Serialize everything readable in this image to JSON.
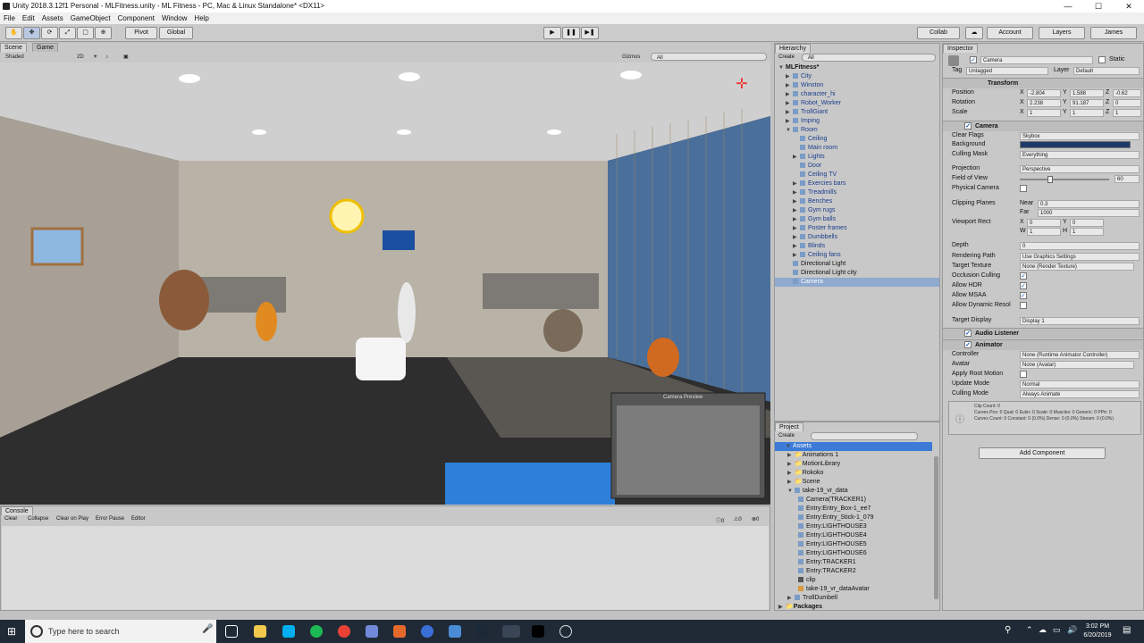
{
  "window": {
    "title": "Unity 2018.3.12f1 Personal - MLFitness.unity - ML Fitness - PC, Mac & Linux Standalone* <DX11>",
    "minimize": "—",
    "maximize": "☐",
    "close": "✕"
  },
  "menu": [
    "File",
    "Edit",
    "Assets",
    "GameObject",
    "Component",
    "Window",
    "Help"
  ],
  "toolbar": {
    "pivot": "Pivot",
    "global": "Global",
    "play": "▶",
    "pause": "❚❚",
    "step": "▶❚",
    "collab": "Collab",
    "account": "Account",
    "layers": "Layers",
    "layout": "James"
  },
  "scene": {
    "tab_scene": "Scene",
    "tab_game": "Game",
    "shading": "Shaded",
    "mode_2d": "2D",
    "gizmos": "Gizmos",
    "search_placeholder": "All",
    "camera_preview": "Camera Preview"
  },
  "hierarchy": {
    "tab": "Hierarchy",
    "create": "Create",
    "search_placeholder": "All",
    "root": "MLFitness*",
    "items": [
      "City",
      "Winston",
      "character_hi",
      "Robot_Worker",
      "TrollGiant",
      "Imping",
      "Room",
      "Ceiling",
      "Main room",
      "Lights",
      "Door",
      "Ceiling TV",
      "Exercies bars",
      "Treadmills",
      "Benches",
      "Gym rugs",
      "Gym balls",
      "Poster frames",
      "Dumbbells",
      "Blinds",
      "Ceiling fans",
      "Directional Light",
      "Directional Light city",
      "Camera"
    ]
  },
  "project": {
    "tab": "Project",
    "create": "Create",
    "items": [
      "Assets",
      "Animations 1",
      "MotionLibrary",
      "Rokoko",
      "Scene",
      "take-19_vr_data",
      "Camera(TRACKER1)",
      "Entry:Entry_Box-1_ee7",
      "Entry:Entry_Stick-1_079",
      "Entry:LIGHTHOUSE3",
      "Entry:LIGHTHOUSE4",
      "Entry:LIGHTHOUSE5",
      "Entry:LIGHTHOUSE6",
      "Entry:TRACKER1",
      "Entry:TRACKER2",
      "clip",
      "take-19_vr_dataAvatar",
      "TrollDumbell",
      "Packages"
    ]
  },
  "inspector": {
    "tab": "Inspector",
    "name": "Camera",
    "static": "Static",
    "tag_label": "Tag",
    "tag": "Untagged",
    "layer_label": "Layer",
    "layer": "Default",
    "transform": {
      "title": "Transform",
      "position": "Position",
      "rotation": "Rotation",
      "scale": "Scale",
      "px": "-2.804",
      "py": "1.588",
      "pz": "-0.62",
      "rx": "2.238",
      "ry": "91.187",
      "rz": "0",
      "sx": "1",
      "sy": "1",
      "sz": "1"
    },
    "camera": {
      "title": "Camera",
      "clear_flags": "Clear Flags",
      "clear_flags_val": "Skybox",
      "background": "Background",
      "culling_mask": "Culling Mask",
      "culling_val": "Everything",
      "projection": "Projection",
      "projection_val": "Perspective",
      "fov": "Field of View",
      "fov_val": "60",
      "fov_level": 0.34,
      "physical": "Physical Camera",
      "clipping": "Clipping Planes",
      "near": "Near",
      "near_val": "0.3",
      "far": "Far",
      "far_val": "1000",
      "viewport": "Viewport Rect",
      "vx": "0",
      "vy": "0",
      "vw": "1",
      "vh": "1",
      "depth": "Depth",
      "depth_val": "0",
      "rendering_path": "Rendering Path",
      "rendering_val": "Use Graphics Settings",
      "target_texture": "Target Texture",
      "target_val": "None (Render Texture)",
      "occlusion": "Occlusion Culling",
      "hdr": "Allow HDR",
      "msaa": "Allow MSAA",
      "dyn_res": "Allow Dynamic Resol",
      "target_display": "Target Display",
      "display_val": "Display 1",
      "bg_color": "#1e3a6a"
    },
    "audio": {
      "title": "Audio Listener"
    },
    "animator": {
      "title": "Animator",
      "controller": "Controller",
      "controller_val": "None (Runtime Animator Controller)",
      "avatar": "Avatar",
      "avatar_val": "None (Avatar)",
      "root_motion": "Apply Root Motion",
      "update_mode": "Update Mode",
      "update_val": "Normal",
      "culling_mode": "Culling Mode",
      "culling_mode_val": "Always Animate",
      "info1": "Clip Count: 0",
      "info2": "Curves Pos: 0 Quat: 0 Euler: 0 Scale: 0 Muscles: 0 Generic: 0 PPtr: 0",
      "info3": "Curves Count: 0 Constant: 0 (0.0%) Dense: 0 (0.0%) Stream: 0 (0.0%)"
    },
    "add_component": "Add Component"
  },
  "console": {
    "tab": "Console",
    "clear": "Clear",
    "collapse": "Collapse",
    "clear_on_play": "Clear on Play",
    "error_pause": "Error Pause",
    "editor": "Editor",
    "c1": "0",
    "c2": "0",
    "c3": "0"
  },
  "taskbar": {
    "search_placeholder": "Type here to search",
    "time": "3:02 PM",
    "date": "6/20/2019"
  }
}
